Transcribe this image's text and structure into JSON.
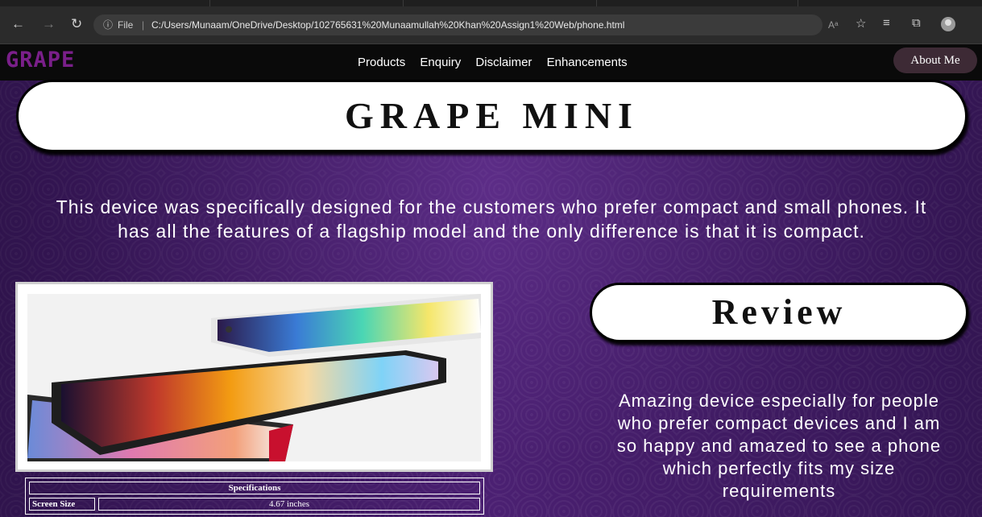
{
  "browser": {
    "info_icon": "info-icon",
    "file_label": "File",
    "url": "C:/Users/Munaam/OneDrive/Desktop/102765631%20Munaamullah%20Khan%20Assign1%20Web/phone.html",
    "read_aloud_label": "Aᵃ"
  },
  "site": {
    "logo": "GRAPE",
    "nav": [
      "Products",
      "Enquiry",
      "Disclaimer",
      "Enhancements"
    ],
    "about_button": "About Me",
    "accent_color": "#7a1f8a"
  },
  "product": {
    "title": "GRAPE MINI",
    "description": "This device was specifically designed for the customers who prefer compact and small phones. It has all the features of a flagship model and the only difference is that it is compact."
  },
  "specs": {
    "header": "Specifications",
    "rows": [
      {
        "label": "Screen Size",
        "value": "4.67 inches"
      }
    ]
  },
  "review": {
    "title": "Review",
    "text": "Amazing device especially for people who prefer compact devices and I am so happy and amazed to see a phone which perfectly fits my size requirements"
  }
}
